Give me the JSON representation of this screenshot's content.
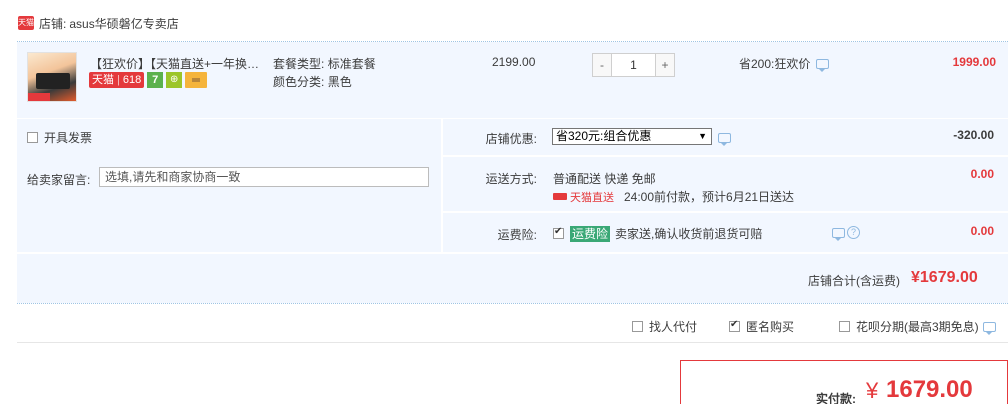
{
  "shop": {
    "badge": "天猫",
    "label": "店铺:",
    "name": "asus华硕磐亿专卖店"
  },
  "item": {
    "title": "【狂欢价】【天猫直送+一年换新】",
    "badge_tmall": "天猫",
    "badge_618": "618",
    "badge_seven": "7",
    "badge_shield": "⊕",
    "spec_type_label": "套餐类型:",
    "spec_type_value": "标准套餐",
    "color_label": "颜色分类:",
    "color_value": "黑色",
    "unit_price": "2199.00",
    "qty_minus": "-",
    "qty_value": "1",
    "qty_plus": "+",
    "discount_text": "省200:狂欢价",
    "total": "1999.00"
  },
  "invoice": {
    "label": "开具发票",
    "checked": false
  },
  "message": {
    "label": "给卖家留言:",
    "placeholder": "选填,请先和商家协商一致"
  },
  "coupon": {
    "label": "店铺优惠:",
    "selected": "省320元:组合优惠",
    "amount": "-320.00"
  },
  "delivery": {
    "label": "运送方式:",
    "method": "普通配送 快递 免邮",
    "direct_tag": "天猫直送",
    "note": "24:00前付款，预计6月21日送达",
    "amount": "0.00"
  },
  "insurance": {
    "label": "运费险:",
    "tag": "运费险",
    "text": "卖家送,确认收货前退货可赔",
    "amount": "0.00"
  },
  "subtotal": {
    "label": "店铺合计(含运费)",
    "value": "¥1679.00"
  },
  "options": {
    "proxy_pay": "找人代付",
    "anonymous": "匿名购买",
    "installment": "花呗分期(最高3期免息)"
  },
  "payment": {
    "label": "实付款:",
    "currency": "¥",
    "value": "1679.00"
  },
  "colors": {
    "accent": "#e4393c",
    "row_bg": "#f2f7ff",
    "link_blue": "#8eb8e0"
  }
}
